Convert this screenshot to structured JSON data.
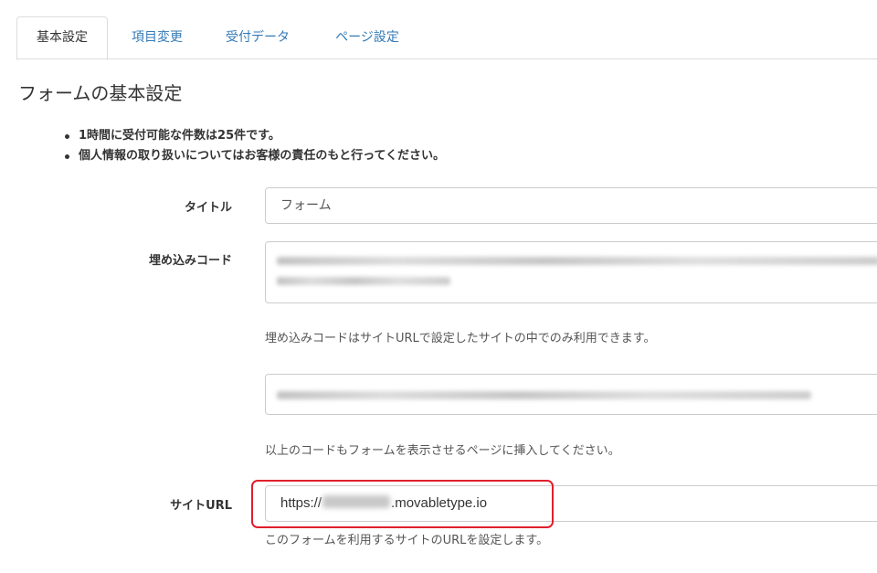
{
  "tabs": [
    {
      "label": "基本設定",
      "active": true
    },
    {
      "label": "項目変更",
      "active": false
    },
    {
      "label": "受付データ",
      "active": false
    },
    {
      "label": "ページ設定",
      "active": false
    }
  ],
  "page_title": "フォームの基本設定",
  "notes": [
    "1時間に受付可能な件数は25件です。",
    "個人情報の取り扱いについてはお客様の責任のもと行ってください。"
  ],
  "form": {
    "title_label": "タイトル",
    "title_value": "フォーム",
    "embed_label": "埋め込みコード",
    "embed_help": "埋め込みコードはサイトURLで設定したサイトの中でのみ利用できます。",
    "code_help": "以上のコードもフォームを表示させるページに挿入してください。",
    "site_url_label": "サイトURL",
    "site_url_prefix": "https://",
    "site_url_suffix": ".movabletype.io",
    "site_url_help": "このフォームを利用するサイトのURLを設定します。"
  },
  "colors": {
    "link_tab": "#337ab7",
    "highlight_border": "#e01f2d"
  }
}
